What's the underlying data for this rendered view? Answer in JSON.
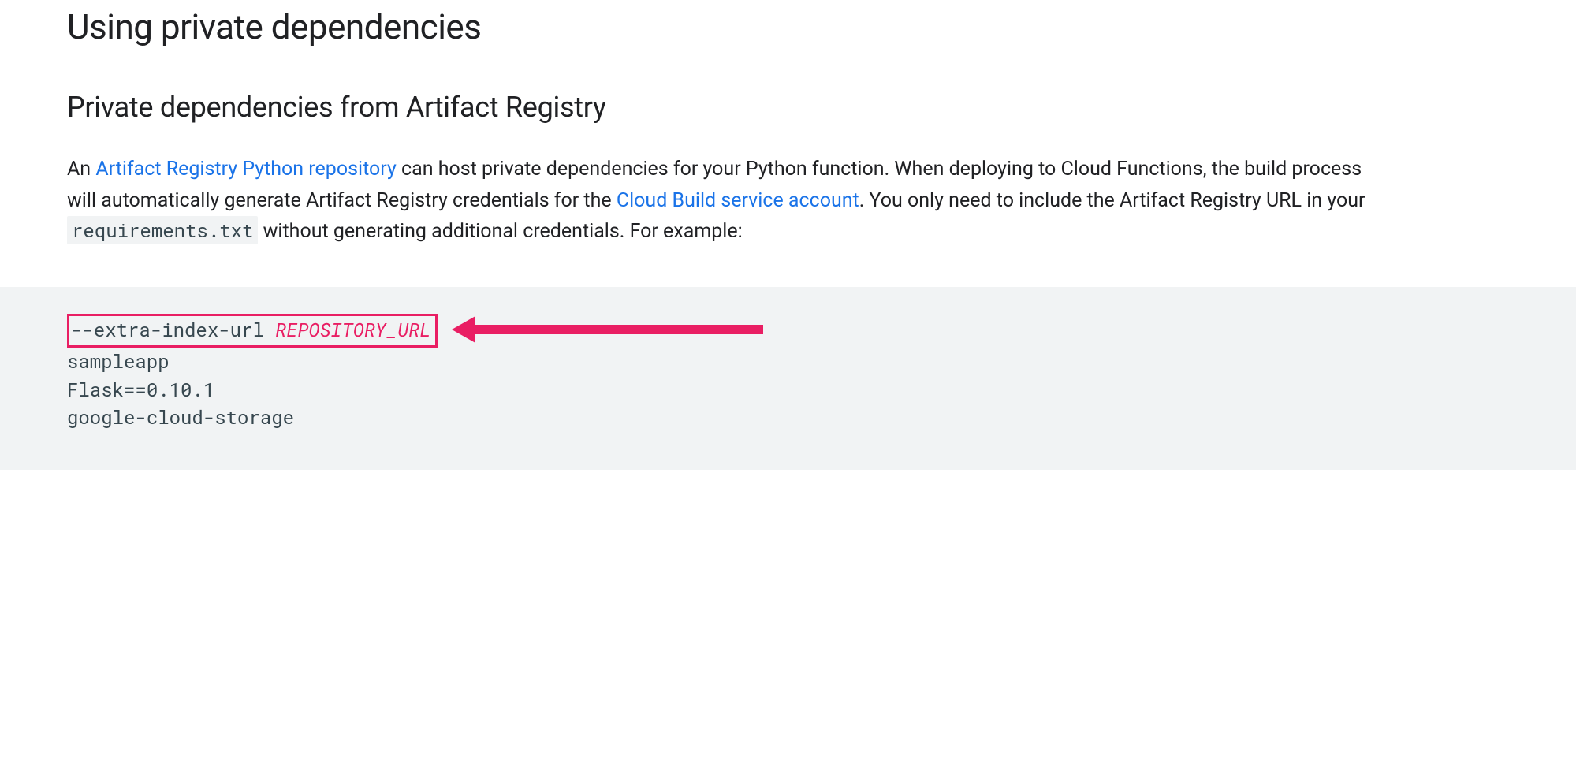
{
  "headings": {
    "h1": "Using private dependencies",
    "h2": "Private dependencies from Artifact Registry"
  },
  "paragraph": {
    "part1": "An ",
    "link1": "Artifact Registry Python repository",
    "part2": " can host private dependencies for your Python function. When deploying to Cloud Functions, the build process will automatically generate Artifact Registry credentials for the ",
    "link2": "Cloud Build service account",
    "part3": ". You only need to include the Artifact Registry URL in your ",
    "code_inline": "requirements.txt",
    "part4": " without generating additional credentials. For example:"
  },
  "code": {
    "highlighted_flag": "--extra-index-url ",
    "highlighted_var": "REPOSITORY_URL",
    "line2": "sampleapp",
    "line3": "Flask==0.10.1",
    "line4": "google-cloud-storage"
  },
  "annotation": {
    "arrow_color": "#e91e63"
  }
}
